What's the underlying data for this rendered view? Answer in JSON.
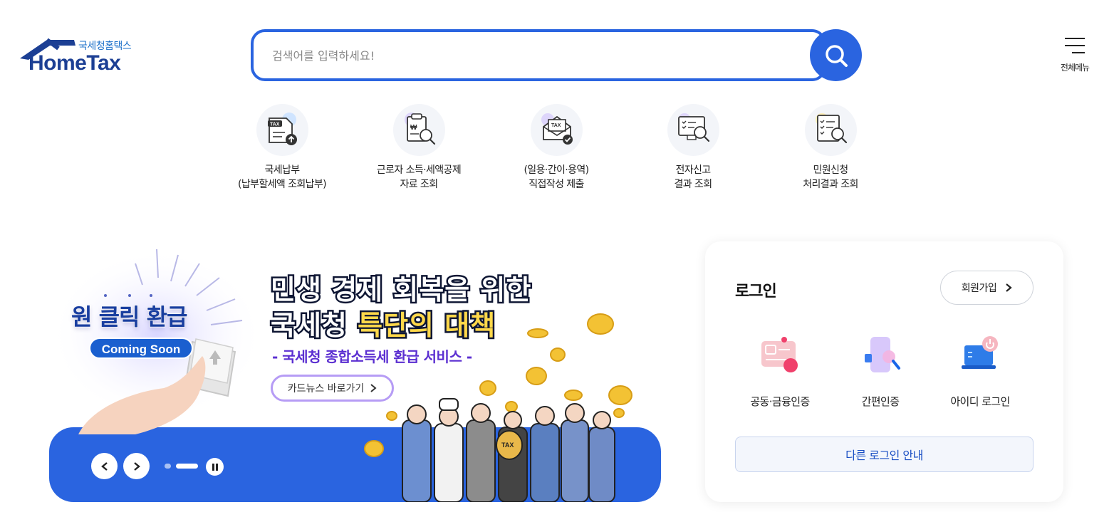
{
  "brand": {
    "sub_name": "국세청홈택스",
    "name": "HomeTax",
    "primary_color": "#2a64e0",
    "logo_color": "#1c3f94"
  },
  "header": {
    "search_placeholder": "검색어를 입력하세요!",
    "search_icon": "search-icon",
    "all_menu_label": "전체메뉴"
  },
  "quick_menu": [
    {
      "line1": "국세납부",
      "line2": "(납부할세액 조회납부)",
      "icon": "tax-payment-icon"
    },
    {
      "line1": "근로자 소득·세액공제",
      "line2": "자료 조회",
      "icon": "deduction-search-icon"
    },
    {
      "line1": "(일용·간이·용역)",
      "line2": "직접작성 제출",
      "icon": "tax-mail-icon"
    },
    {
      "line1": "전자신고",
      "line2": "결과 조회",
      "icon": "monitor-search-icon"
    },
    {
      "line1": "민원신청",
      "line2": "처리결과 조회",
      "icon": "document-search-icon"
    }
  ],
  "banner": {
    "badge_title": "원 클릭 환급",
    "badge_status": "Coming Soon",
    "headline_1": "민생 경제 회복을 위한",
    "headline_2_a": "국세청 ",
    "headline_2_b": "특단의 대책",
    "subline": "- 국세청 종합소득세 환급 서비스 -",
    "link_label": "카드뉴스 바로가기",
    "slide_active_index": 1
  },
  "login": {
    "title": "로그인",
    "signup_label": "회원가입",
    "options": [
      {
        "label": "공동·금융인증",
        "icon": "certificate-card-icon"
      },
      {
        "label": "간편인증",
        "icon": "phone-search-icon"
      },
      {
        "label": "아이디 로그인",
        "icon": "laptop-power-icon"
      }
    ],
    "other_login_label": "다른 로그인 안내"
  }
}
